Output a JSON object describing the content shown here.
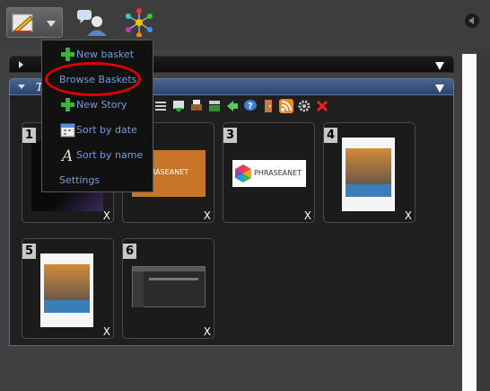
{
  "toolbar": {
    "tools": [
      {
        "name": "edit-tool",
        "icon": "pencil-ruler-icon",
        "active": true
      },
      {
        "name": "users-tool",
        "icon": "user-chat-icon"
      },
      {
        "name": "network-tool",
        "icon": "network-nodes-icon"
      }
    ]
  },
  "dropdown": {
    "items": [
      {
        "label": "New basket",
        "icon": "green-plus-icon"
      },
      {
        "label": "Browse Baskets",
        "icon": "",
        "highlighted": true
      },
      {
        "label": "New Story",
        "icon": "green-plus-icon"
      },
      {
        "label": "Sort by date",
        "icon": "calendar-icon"
      },
      {
        "label": "Sort by name",
        "icon": "font-letter-a-icon"
      },
      {
        "label": "Settings",
        "icon": ""
      }
    ],
    "highlight_color": "#e00000"
  },
  "panel": {
    "open_title": "T",
    "accent_color": "#3a5788"
  },
  "thumbnails": [
    {
      "number": "1",
      "close": "X",
      "content": "dark-image"
    },
    {
      "number": "2",
      "close": "X",
      "content": "phraseanet-orange",
      "logo_text": "PHRASEANET"
    },
    {
      "number": "3",
      "close": "X",
      "content": "phraseanet-white",
      "logo_text": "PHRASEANET"
    },
    {
      "number": "4",
      "close": "X",
      "content": "brochure"
    },
    {
      "number": "5",
      "close": "X",
      "content": "brochure"
    },
    {
      "number": "6",
      "close": "X",
      "content": "screenshot"
    }
  ]
}
